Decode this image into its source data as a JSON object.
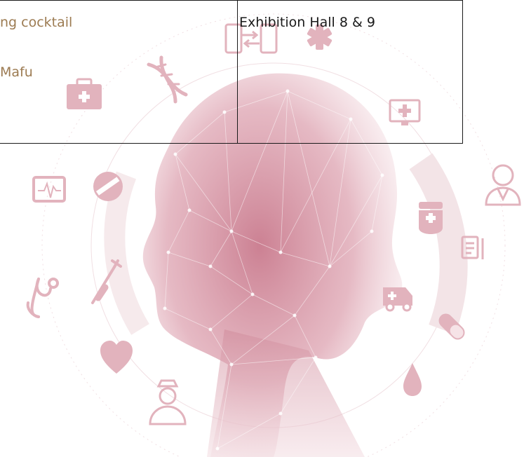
{
  "schedule": {
    "event_line_1": "ng cocktail",
    "event_line_2": "Mafu",
    "venue": "Exhibition Hall 8 & 9"
  },
  "background": {
    "theme": "medical-digital-face",
    "accent_color": "#d49aa7",
    "icon_color": "#e2b3bd",
    "icons": [
      "phone-transfer-icon",
      "star-of-life-icon",
      "dna-icon",
      "first-aid-kit-icon",
      "monitor-health-icon",
      "ecg-monitor-icon",
      "pill-icon",
      "doctor-icon",
      "medicine-bottle-icon",
      "clipboard-icon",
      "syringe-icon",
      "stethoscope-icon",
      "ambulance-icon",
      "capsule-icon",
      "heart-icon",
      "blood-drop-icon",
      "nurse-icon"
    ]
  }
}
